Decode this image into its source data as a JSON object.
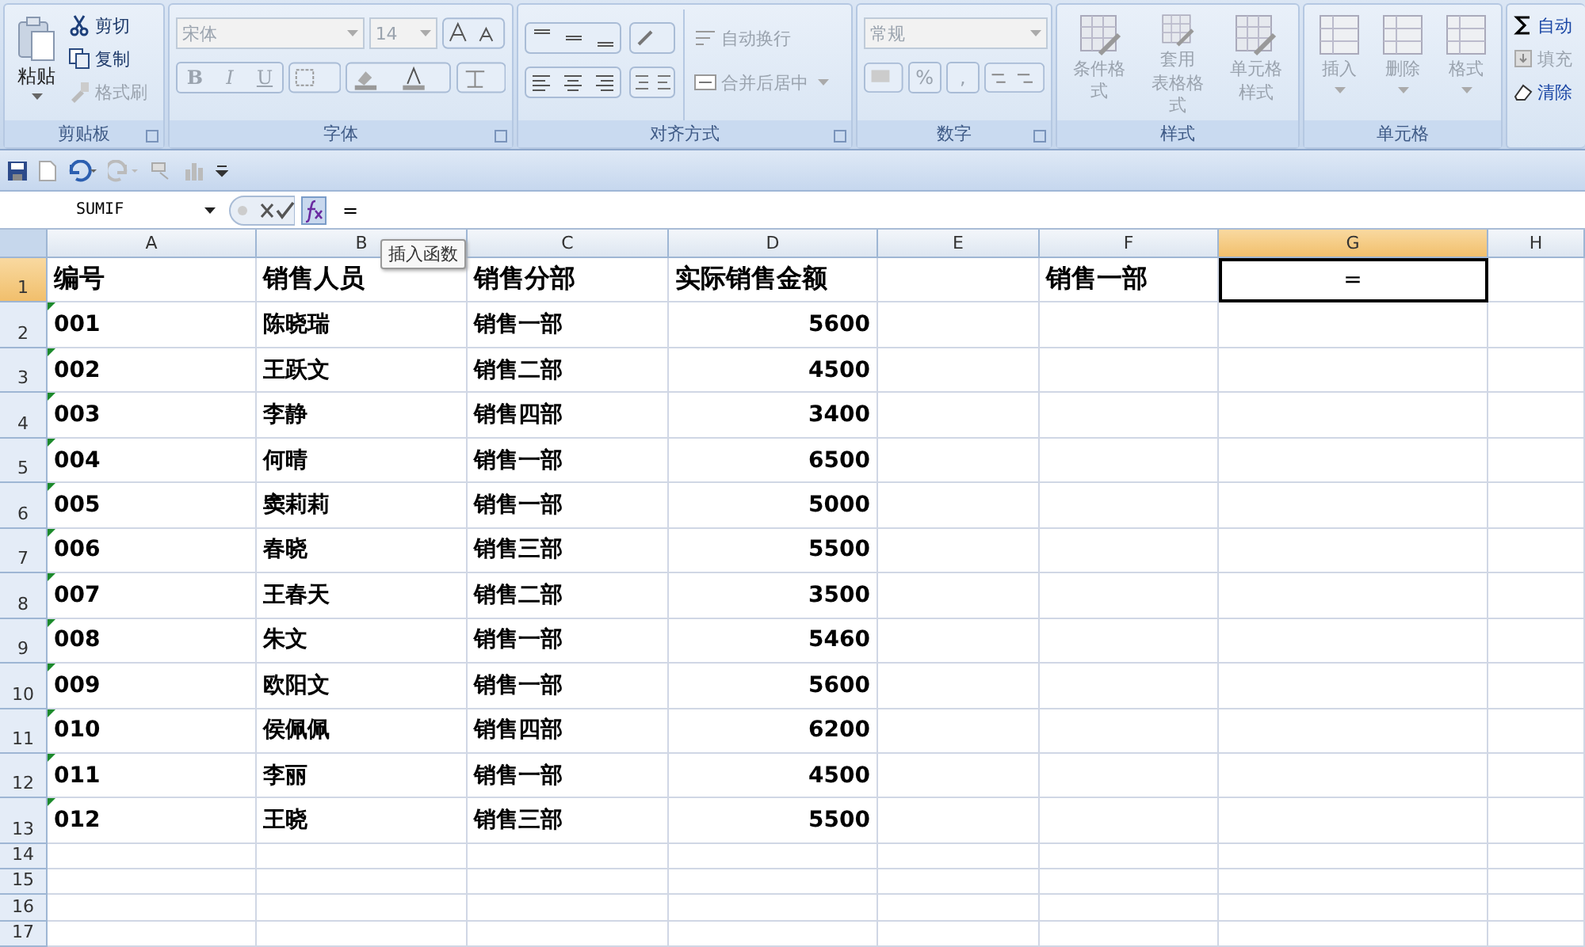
{
  "ribbon": {
    "clipboard": {
      "title": "剪贴板",
      "paste": {
        "label": "粘贴"
      },
      "tools": [
        {
          "label": "剪切",
          "disabled": false
        },
        {
          "label": "复制",
          "disabled": false
        },
        {
          "label": "格式刷",
          "disabled": true
        }
      ]
    },
    "font": {
      "title": "字体",
      "font_name": "宋体",
      "font_size": "14",
      "styles": [
        "B",
        "I",
        "U"
      ],
      "disabled": true
    },
    "alignment": {
      "title": "对齐方式",
      "wrap": {
        "label": "自动换行",
        "disabled": true
      },
      "merge": {
        "label": "合并后居中",
        "disabled": true
      }
    },
    "number": {
      "title": "数字",
      "format": "常规",
      "symbols": [
        "%",
        ","
      ],
      "disabled": true
    },
    "styles": {
      "title": "样式",
      "buttons": [
        {
          "lines": [
            "条件格式"
          ]
        },
        {
          "lines": [
            "套用",
            "表格格式"
          ]
        },
        {
          "lines": [
            "单元格",
            "样式"
          ]
        }
      ],
      "disabled": true
    },
    "cells": {
      "title": "单元格",
      "buttons": [
        "插入",
        "删除",
        "格式"
      ],
      "disabled": true
    },
    "editing": {
      "tools": [
        {
          "label": "自动",
          "disabled": false
        },
        {
          "label": "填充",
          "disabled": true
        },
        {
          "label": "清除",
          "disabled": false
        }
      ]
    }
  },
  "formula_bar": {
    "name_box": "SUMIF",
    "formula": "=",
    "tooltip": "插入函数"
  },
  "sheet": {
    "columns": [
      {
        "label": "A",
        "selected": false
      },
      {
        "label": "B",
        "selected": false
      },
      {
        "label": "C",
        "selected": false
      },
      {
        "label": "D",
        "selected": false
      },
      {
        "label": "E",
        "selected": false
      },
      {
        "label": "F",
        "selected": false
      },
      {
        "label": "G",
        "selected": true
      },
      {
        "label": "H",
        "selected": false
      }
    ],
    "rows": [
      {
        "number": "1",
        "selected": true,
        "cells": {
          "a": {
            "kind": "header",
            "text": "编号"
          },
          "b": {
            "kind": "header",
            "text": "销售人员"
          },
          "c": {
            "kind": "header",
            "text": "销售分部"
          },
          "d": {
            "kind": "header",
            "text": "实际销售金额"
          },
          "f": {
            "kind": "header",
            "text": "销售一部"
          },
          "g": {
            "kind": "formula",
            "text": "=",
            "selected": true
          }
        }
      },
      {
        "number": "2",
        "selected": false,
        "cells": {
          "a": {
            "kind": "text",
            "text": "001",
            "warning": true
          },
          "b": {
            "kind": "text",
            "text": "陈晓瑞"
          },
          "c": {
            "kind": "text",
            "text": "销售一部"
          },
          "d": {
            "kind": "number",
            "text": "5600"
          }
        }
      },
      {
        "number": "3",
        "selected": false,
        "cells": {
          "a": {
            "kind": "text",
            "text": "002",
            "warning": true
          },
          "b": {
            "kind": "text",
            "text": "王跃文"
          },
          "c": {
            "kind": "text",
            "text": "销售二部"
          },
          "d": {
            "kind": "number",
            "text": "4500"
          }
        }
      },
      {
        "number": "4",
        "selected": false,
        "cells": {
          "a": {
            "kind": "text",
            "text": "003",
            "warning": true
          },
          "b": {
            "kind": "text",
            "text": "李静"
          },
          "c": {
            "kind": "text",
            "text": "销售四部"
          },
          "d": {
            "kind": "number",
            "text": "3400"
          }
        }
      },
      {
        "number": "5",
        "selected": false,
        "cells": {
          "a": {
            "kind": "text",
            "text": "004",
            "warning": true
          },
          "b": {
            "kind": "text",
            "text": "何晴"
          },
          "c": {
            "kind": "text",
            "text": "销售一部"
          },
          "d": {
            "kind": "number",
            "text": "6500"
          }
        }
      },
      {
        "number": "6",
        "selected": false,
        "cells": {
          "a": {
            "kind": "text",
            "text": "005",
            "warning": true
          },
          "b": {
            "kind": "text",
            "text": "窦莉莉"
          },
          "c": {
            "kind": "text",
            "text": "销售一部"
          },
          "d": {
            "kind": "number",
            "text": "5000"
          }
        }
      },
      {
        "number": "7",
        "selected": false,
        "cells": {
          "a": {
            "kind": "text",
            "text": "006",
            "warning": true
          },
          "b": {
            "kind": "text",
            "text": "春晓"
          },
          "c": {
            "kind": "text",
            "text": "销售三部"
          },
          "d": {
            "kind": "number",
            "text": "5500"
          }
        }
      },
      {
        "number": "8",
        "selected": false,
        "cells": {
          "a": {
            "kind": "text",
            "text": "007",
            "warning": true
          },
          "b": {
            "kind": "text",
            "text": "王春天"
          },
          "c": {
            "kind": "text",
            "text": "销售二部"
          },
          "d": {
            "kind": "number",
            "text": "3500"
          }
        }
      },
      {
        "number": "9",
        "selected": false,
        "cells": {
          "a": {
            "kind": "text",
            "text": "008",
            "warning": true
          },
          "b": {
            "kind": "text",
            "text": "朱文"
          },
          "c": {
            "kind": "text",
            "text": "销售一部"
          },
          "d": {
            "kind": "number",
            "text": "5460"
          }
        }
      },
      {
        "number": "10",
        "selected": false,
        "cells": {
          "a": {
            "kind": "text",
            "text": "009",
            "warning": true
          },
          "b": {
            "kind": "text",
            "text": "欧阳文"
          },
          "c": {
            "kind": "text",
            "text": "销售一部"
          },
          "d": {
            "kind": "number",
            "text": "5600"
          }
        }
      },
      {
        "number": "11",
        "selected": false,
        "cells": {
          "a": {
            "kind": "text",
            "text": "010",
            "warning": true
          },
          "b": {
            "kind": "text",
            "text": "侯佩佩"
          },
          "c": {
            "kind": "text",
            "text": "销售四部"
          },
          "d": {
            "kind": "number",
            "text": "6200"
          }
        }
      },
      {
        "number": "12",
        "selected": false,
        "cells": {
          "a": {
            "kind": "text",
            "text": "011",
            "warning": true
          },
          "b": {
            "kind": "text",
            "text": "李丽"
          },
          "c": {
            "kind": "text",
            "text": "销售一部"
          },
          "d": {
            "kind": "number",
            "text": "4500"
          }
        }
      },
      {
        "number": "13",
        "selected": false,
        "cells": {
          "a": {
            "kind": "text",
            "text": "012",
            "warning": true
          },
          "b": {
            "kind": "text",
            "text": "王晓"
          },
          "c": {
            "kind": "text",
            "text": "销售三部"
          },
          "d": {
            "kind": "number",
            "text": "5500"
          }
        }
      },
      {
        "number": "14",
        "selected": false
      },
      {
        "number": "15",
        "selected": false
      },
      {
        "number": "16",
        "selected": false
      },
      {
        "number": "17",
        "selected": false
      }
    ]
  }
}
